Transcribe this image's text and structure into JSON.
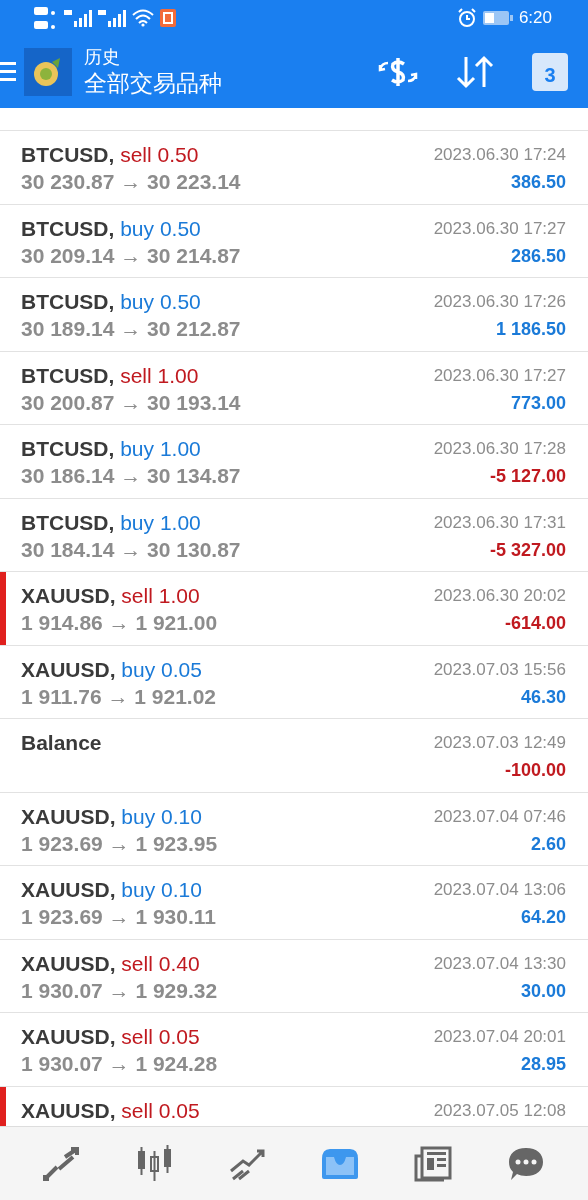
{
  "status_bar": {
    "time": "6:20"
  },
  "app_bar": {
    "title": "历史",
    "subtitle": "全部交易品种",
    "calendar_day": "3"
  },
  "deals": [
    {
      "kind": "trade",
      "symbol": "BTCUSD,",
      "type": "sell",
      "volume": "0.50",
      "prices": "30 230.87 → 30 223.14",
      "time": "2023.06.30 17:24",
      "profit": "386.50",
      "loss": false,
      "marked": false
    },
    {
      "kind": "trade",
      "symbol": "BTCUSD,",
      "type": "buy",
      "volume": "0.50",
      "prices": "30 209.14 → 30 214.87",
      "time": "2023.06.30 17:27",
      "profit": "286.50",
      "loss": false,
      "marked": false
    },
    {
      "kind": "trade",
      "symbol": "BTCUSD,",
      "type": "buy",
      "volume": "0.50",
      "prices": "30 189.14 → 30 212.87",
      "time": "2023.06.30 17:26",
      "profit": "1 186.50",
      "loss": false,
      "marked": false
    },
    {
      "kind": "trade",
      "symbol": "BTCUSD,",
      "type": "sell",
      "volume": "1.00",
      "prices": "30 200.87 → 30 193.14",
      "time": "2023.06.30 17:27",
      "profit": "773.00",
      "loss": false,
      "marked": false
    },
    {
      "kind": "trade",
      "symbol": "BTCUSD,",
      "type": "buy",
      "volume": "1.00",
      "prices": "30 186.14 → 30 134.87",
      "time": "2023.06.30 17:28",
      "profit": "-5 127.00",
      "loss": true,
      "marked": false
    },
    {
      "kind": "trade",
      "symbol": "BTCUSD,",
      "type": "buy",
      "volume": "1.00",
      "prices": "30 184.14 → 30 130.87",
      "time": "2023.06.30 17:31",
      "profit": "-5 327.00",
      "loss": true,
      "marked": false
    },
    {
      "kind": "trade",
      "symbol": "XAUUSD,",
      "type": "sell",
      "volume": "1.00",
      "prices": "1 914.86 → 1 921.00",
      "time": "2023.06.30 20:02",
      "profit": "-614.00",
      "loss": true,
      "marked": true
    },
    {
      "kind": "trade",
      "symbol": "XAUUSD,",
      "type": "buy",
      "volume": "0.05",
      "prices": "1 911.76 → 1 921.02",
      "time": "2023.07.03 15:56",
      "profit": "46.30",
      "loss": false,
      "marked": false
    },
    {
      "kind": "balance",
      "symbol": "Balance",
      "time": "2023.07.03 12:49",
      "profit": "-100.00",
      "loss": true,
      "marked": false
    },
    {
      "kind": "trade",
      "symbol": "XAUUSD,",
      "type": "buy",
      "volume": "0.10",
      "prices": "1 923.69 → 1 923.95",
      "time": "2023.07.04 07:46",
      "profit": "2.60",
      "loss": false,
      "marked": false
    },
    {
      "kind": "trade",
      "symbol": "XAUUSD,",
      "type": "buy",
      "volume": "0.10",
      "prices": "1 923.69 → 1 930.11",
      "time": "2023.07.04 13:06",
      "profit": "64.20",
      "loss": false,
      "marked": false
    },
    {
      "kind": "trade",
      "symbol": "XAUUSD,",
      "type": "sell",
      "volume": "0.40",
      "prices": "1 930.07 → 1 929.32",
      "time": "2023.07.04 13:30",
      "profit": "30.00",
      "loss": false,
      "marked": false
    },
    {
      "kind": "trade",
      "symbol": "XAUUSD,",
      "type": "sell",
      "volume": "0.05",
      "prices": "1 930.07 → 1 924.28",
      "time": "2023.07.04 20:01",
      "profit": "28.95",
      "loss": false,
      "marked": false
    },
    {
      "kind": "trade",
      "symbol": "XAUUSD,",
      "type": "sell",
      "volume": "0.05",
      "time": "2023.07.05 12:08",
      "marked": true
    }
  ],
  "bottom_nav": [
    {
      "selected": false
    },
    {
      "selected": false
    },
    {
      "selected": false
    },
    {
      "selected": true
    },
    {
      "selected": false
    },
    {
      "selected": false
    }
  ]
}
